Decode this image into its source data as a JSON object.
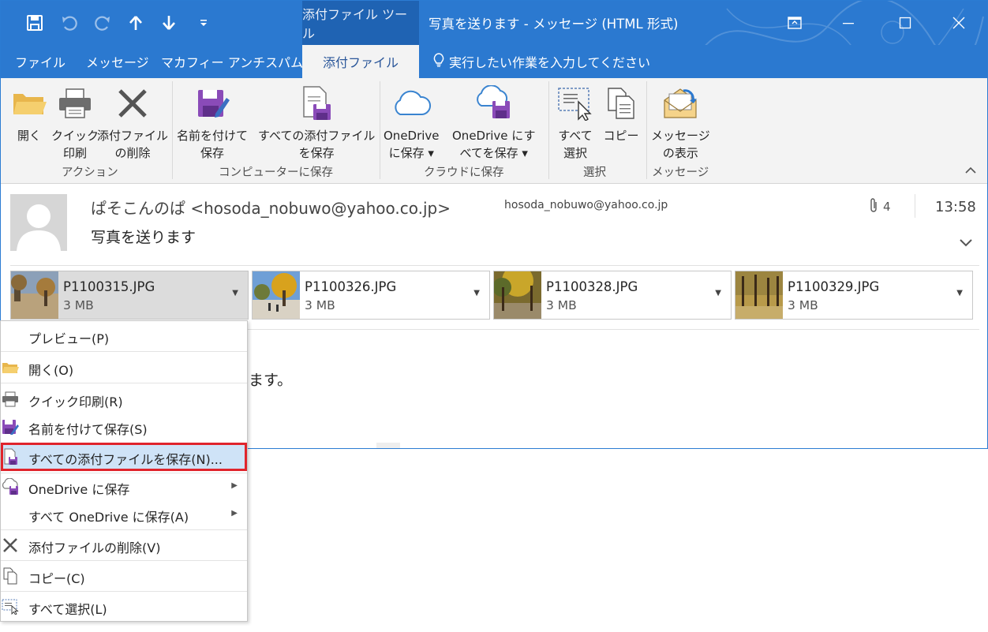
{
  "window": {
    "tool_context": "添付ファイル ツール",
    "title": "写真を送ります  -  メッセージ (HTML 形式)"
  },
  "tabs": {
    "file": "ファイル",
    "message": "メッセージ",
    "mcafee": "マカフィー アンチスパム",
    "attachments": "添付ファイル"
  },
  "tell_me": "実行したい作業を入力してください",
  "ribbon": {
    "open": "開く",
    "quick_print_1": "クイック",
    "quick_print_2": "印刷",
    "remove_1": "添付ファイル",
    "remove_2": "の削除",
    "save_as_1": "名前を付けて",
    "save_as_2": "保存",
    "save_all_1": "すべての添付ファイル",
    "save_all_2": "を保存",
    "od_save_1": "OneDrive",
    "od_save_2": "に保存 ▾",
    "od_all_1": "OneDrive にす",
    "od_all_2": "べてを保存 ▾",
    "select_all_1": "すべて",
    "select_all_2": "選択",
    "copy": "コピー",
    "show_msg_1": "メッセージ",
    "show_msg_2": "の表示",
    "group_actions": "アクション",
    "group_save_pc": "コンピューターに保存",
    "group_save_cloud": "クラウドに保存",
    "group_select": "選択",
    "group_message": "メッセージ"
  },
  "message": {
    "sender": "ぱそこんのぱ <hosoda_nobuwo@yahoo.co.jp>",
    "to": "hosoda_nobuwo@yahoo.co.jp",
    "attachment_count": "4",
    "time": "13:58",
    "subject": "写真を送ります",
    "body_fragment": "ます。"
  },
  "attachments": [
    {
      "name": "P1100315.JPG",
      "size": "3 MB"
    },
    {
      "name": "P1100326.JPG",
      "size": "3 MB"
    },
    {
      "name": "P1100328.JPG",
      "size": "3 MB"
    },
    {
      "name": "P1100329.JPG",
      "size": "3 MB"
    }
  ],
  "context_menu": {
    "preview": "プレビュー(P)",
    "open": "開く(O)",
    "quick_print": "クイック印刷(R)",
    "save_as": "名前を付けて保存(S)",
    "save_all": "すべての添付ファイルを保存(N)...",
    "save_onedrive": "OneDrive に保存",
    "save_all_onedrive": "すべて OneDrive に保存(A)",
    "remove": "添付ファイルの削除(V)",
    "copy": "コピー(C)",
    "select_all": "すべて選択(L)"
  },
  "colors": {
    "titlebar": "#2b79d0",
    "context_tab": "#1f63b3",
    "ribbon": "#f3f3f3",
    "highlight_border": "#e0242c",
    "save_icon_purple": "#8a4bb8"
  }
}
